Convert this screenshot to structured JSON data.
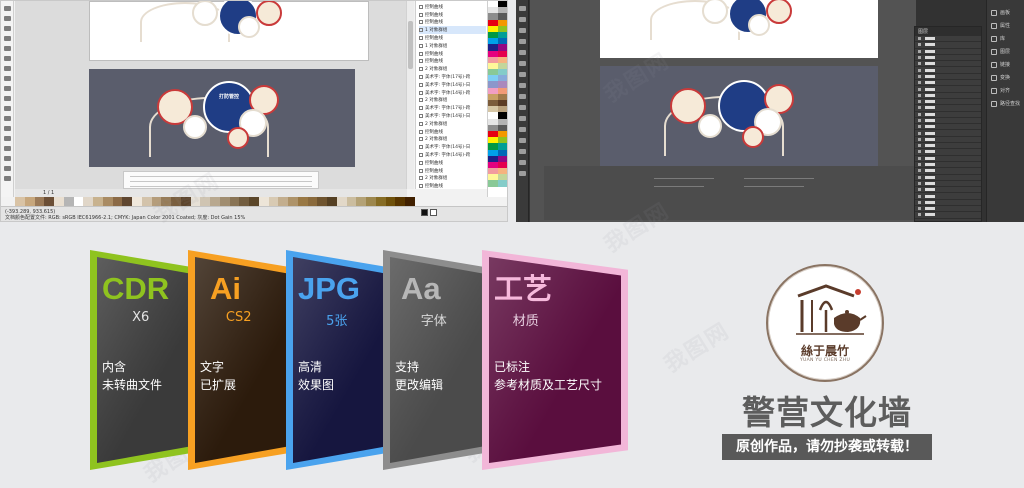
{
  "corel": {
    "object_manager": [
      "控制曲线",
      "控制曲线",
      "控制曲线",
      "1 对象群组",
      "控制曲线",
      "1 对象群组",
      "控制曲线",
      "控制曲线",
      "2 对象群组",
      "美术字: 字体(17号)-跨",
      "美术字: 字体(14号)-日",
      "美术字: 字体(14号)-跨",
      "2 对象群组",
      "美术字: 字体(17号)-跨",
      "美术字: 字体(14号)-日",
      "2 对象群组",
      "控制曲线",
      "2 对象群组",
      "美术字: 字体(14号)-日",
      "美术字: 字体(14号)-跨",
      "控制曲线",
      "控制曲线",
      "2 对象群组",
      "控制曲线"
    ],
    "page_indicator": "1 / 1",
    "status_line1": "(-393.289, 933.615)",
    "status_line2": "文档颜色配置文件: RGB: sRGB IEC61966-2.1; CMYK: Japan Color 2001 Coated; 灰度: Dot Gain 15%"
  },
  "wall": {
    "shield_text": "打防管控"
  },
  "illustrator": {
    "layers_header": "图层",
    "layer_rows": [
      "",
      "",
      "",
      "",
      "",
      "",
      "",
      "",
      "",
      "",
      "",
      "",
      "",
      "",
      "",
      "",
      "",
      "",
      "",
      "",
      "",
      "",
      "",
      "",
      "",
      "",
      "",
      "",
      ""
    ],
    "panels": [
      "画板",
      "属性",
      "库",
      "图层",
      "链接",
      "变换",
      "对齐",
      "路径查找"
    ]
  },
  "watermark": "我图网",
  "cards": [
    {
      "big": "CDR",
      "sub": "X6",
      "desc1": "内含",
      "desc2": "未转曲文件",
      "accent": "#8fc31f"
    },
    {
      "big": "Ai",
      "sub": "CS2",
      "desc1": "文字",
      "desc2": "已扩展",
      "accent": "#f7a022"
    },
    {
      "big": "JPG",
      "sub": "5张",
      "desc1": "高清",
      "desc2": "效果图",
      "accent": "#4aa3ee"
    },
    {
      "big": "Aa",
      "sub": "字体",
      "desc1": "支持",
      "desc2": "更改编辑",
      "accent": "#8d8d8d"
    },
    {
      "big": "工艺",
      "sub": "材质",
      "desc1": "已标注",
      "desc2": "参考材质及工艺尺寸",
      "accent": "#f2b6d8"
    }
  ],
  "logo": {
    "name": "絲于晨竹",
    "pinyin": "YUAN YU CHEN ZHU"
  },
  "title": "警营文化墙",
  "notice": "原创作品，请勿抄袭或转载！"
}
